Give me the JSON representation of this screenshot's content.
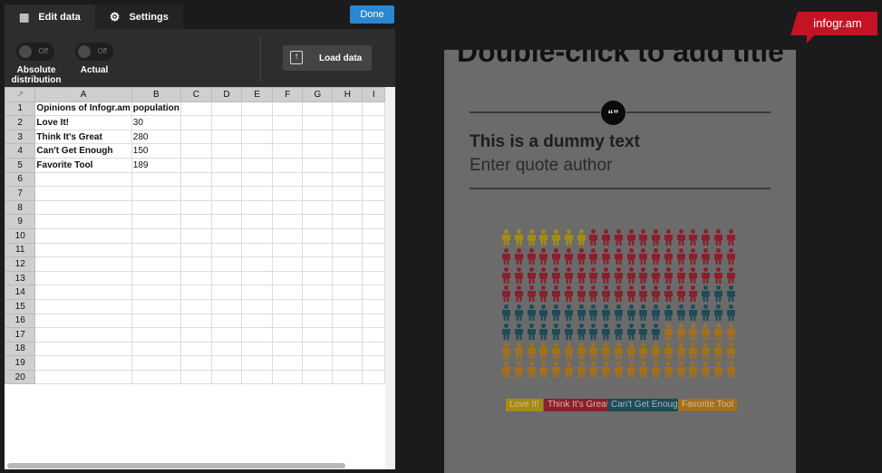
{
  "editor": {
    "tabs": [
      {
        "label": "Edit data",
        "icon": "grid-icon"
      },
      {
        "label": "Settings",
        "icon": "gear-icon"
      }
    ],
    "done_label": "Done",
    "toggles": [
      {
        "label": "Absolute distribution",
        "state": "Off"
      },
      {
        "label": "Actual",
        "state": "Off"
      }
    ],
    "load_label": "Load data"
  },
  "sheet": {
    "columns": [
      "A",
      "B",
      "C",
      "D",
      "E",
      "F",
      "G",
      "H",
      "I"
    ],
    "rows": [
      [
        "Opinions of Infogr.am",
        "population"
      ],
      [
        "Love It!",
        "30"
      ],
      [
        "Think It's Great",
        "280"
      ],
      [
        "Can't Get Enough",
        "150"
      ],
      [
        "Favorite Tool",
        "189"
      ]
    ],
    "row_count": 20
  },
  "preview": {
    "logo": "infogr.am",
    "title": "Double-click to add title",
    "quote_text": "This is a dummy text",
    "quote_author": "Enter quote author",
    "chart": {
      "categories": [
        "Love It!",
        "Think It's Great",
        "Can't Get Enough",
        "Favorite Tool"
      ],
      "icon_counts": [
        7,
        66,
        35,
        44
      ],
      "colors": [
        "#a38c12",
        "#8b1f2b",
        "#1f4b57",
        "#a3701c"
      ]
    }
  }
}
